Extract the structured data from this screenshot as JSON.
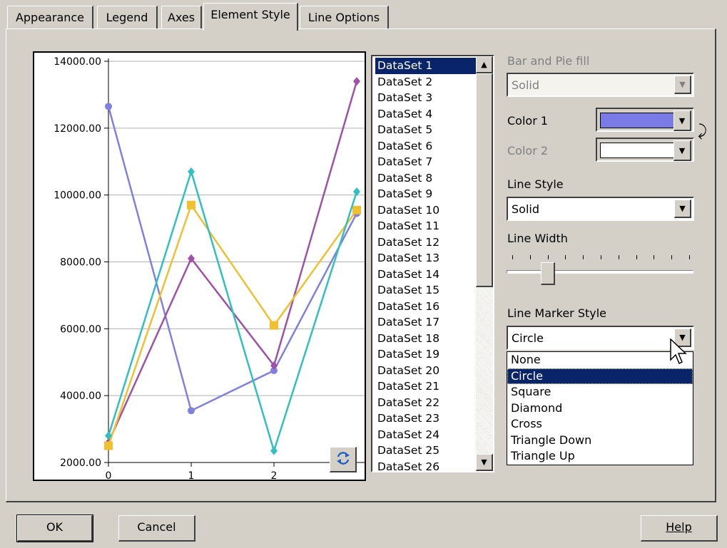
{
  "tabs": [
    {
      "label": "Appearance"
    },
    {
      "label": "Legend"
    },
    {
      "label": "Axes"
    },
    {
      "label": "Element Style"
    },
    {
      "label": "Line Options"
    }
  ],
  "active_tab": "Element Style",
  "chart_data": {
    "type": "line",
    "x": [
      0,
      1,
      2,
      3
    ],
    "ylim": [
      2000,
      14000
    ],
    "y_ticks": [
      "2000.00",
      "4000.00",
      "6000.00",
      "8000.00",
      "10000.00",
      "12000.00",
      "14000.00"
    ],
    "x_ticks": [
      "0",
      "1",
      "2"
    ],
    "grid": true,
    "series": [
      {
        "color": "#8080e0",
        "marker": "circle",
        "values": [
          12650,
          3550,
          4750,
          9450
        ]
      },
      {
        "color": "#a050a8",
        "marker": "diamond",
        "values": [
          2600,
          8100,
          4900,
          13400
        ]
      },
      {
        "color": "#f0c030",
        "marker": "square",
        "values": [
          2500,
          9700,
          6100,
          9550
        ]
      },
      {
        "color": "#30c0c0",
        "marker": "diamond",
        "values": [
          2800,
          10700,
          2350,
          10100
        ]
      }
    ]
  },
  "refresh_icon": "refresh-icon",
  "datasets": {
    "items": [
      "DataSet 1",
      "DataSet 2",
      "DataSet 3",
      "DataSet 4",
      "DataSet 5",
      "DataSet 6",
      "DataSet 7",
      "DataSet 8",
      "DataSet 9",
      "DataSet 10",
      "DataSet 11",
      "DataSet 12",
      "DataSet 13",
      "DataSet 14",
      "DataSet 15",
      "DataSet 16",
      "DataSet 17",
      "DataSet 18",
      "DataSet 19",
      "DataSet 20",
      "DataSet 21",
      "DataSet 22",
      "DataSet 23",
      "DataSet 24",
      "DataSet 25",
      "DataSet 26"
    ],
    "selected": "DataSet 1"
  },
  "style": {
    "bar_pie_fill_label": "Bar and Pie fill",
    "bar_pie_fill_value": "Solid",
    "color1_label": "Color 1",
    "color1_value": "#7b7be8",
    "color2_label": "Color 2",
    "color2_value": "#ffffff",
    "line_style_label": "Line Style",
    "line_style_value": "Solid",
    "line_width_label": "Line Width",
    "line_width_value": 1,
    "line_width_max": 11,
    "marker_style_label": "Line Marker Style",
    "marker_style_value": "Circle",
    "marker_options": [
      "None",
      "Circle",
      "Square",
      "Diamond",
      "Cross",
      "Triangle Down",
      "Triangle Up"
    ]
  },
  "buttons": {
    "ok": "OK",
    "cancel": "Cancel",
    "help": "Help"
  }
}
